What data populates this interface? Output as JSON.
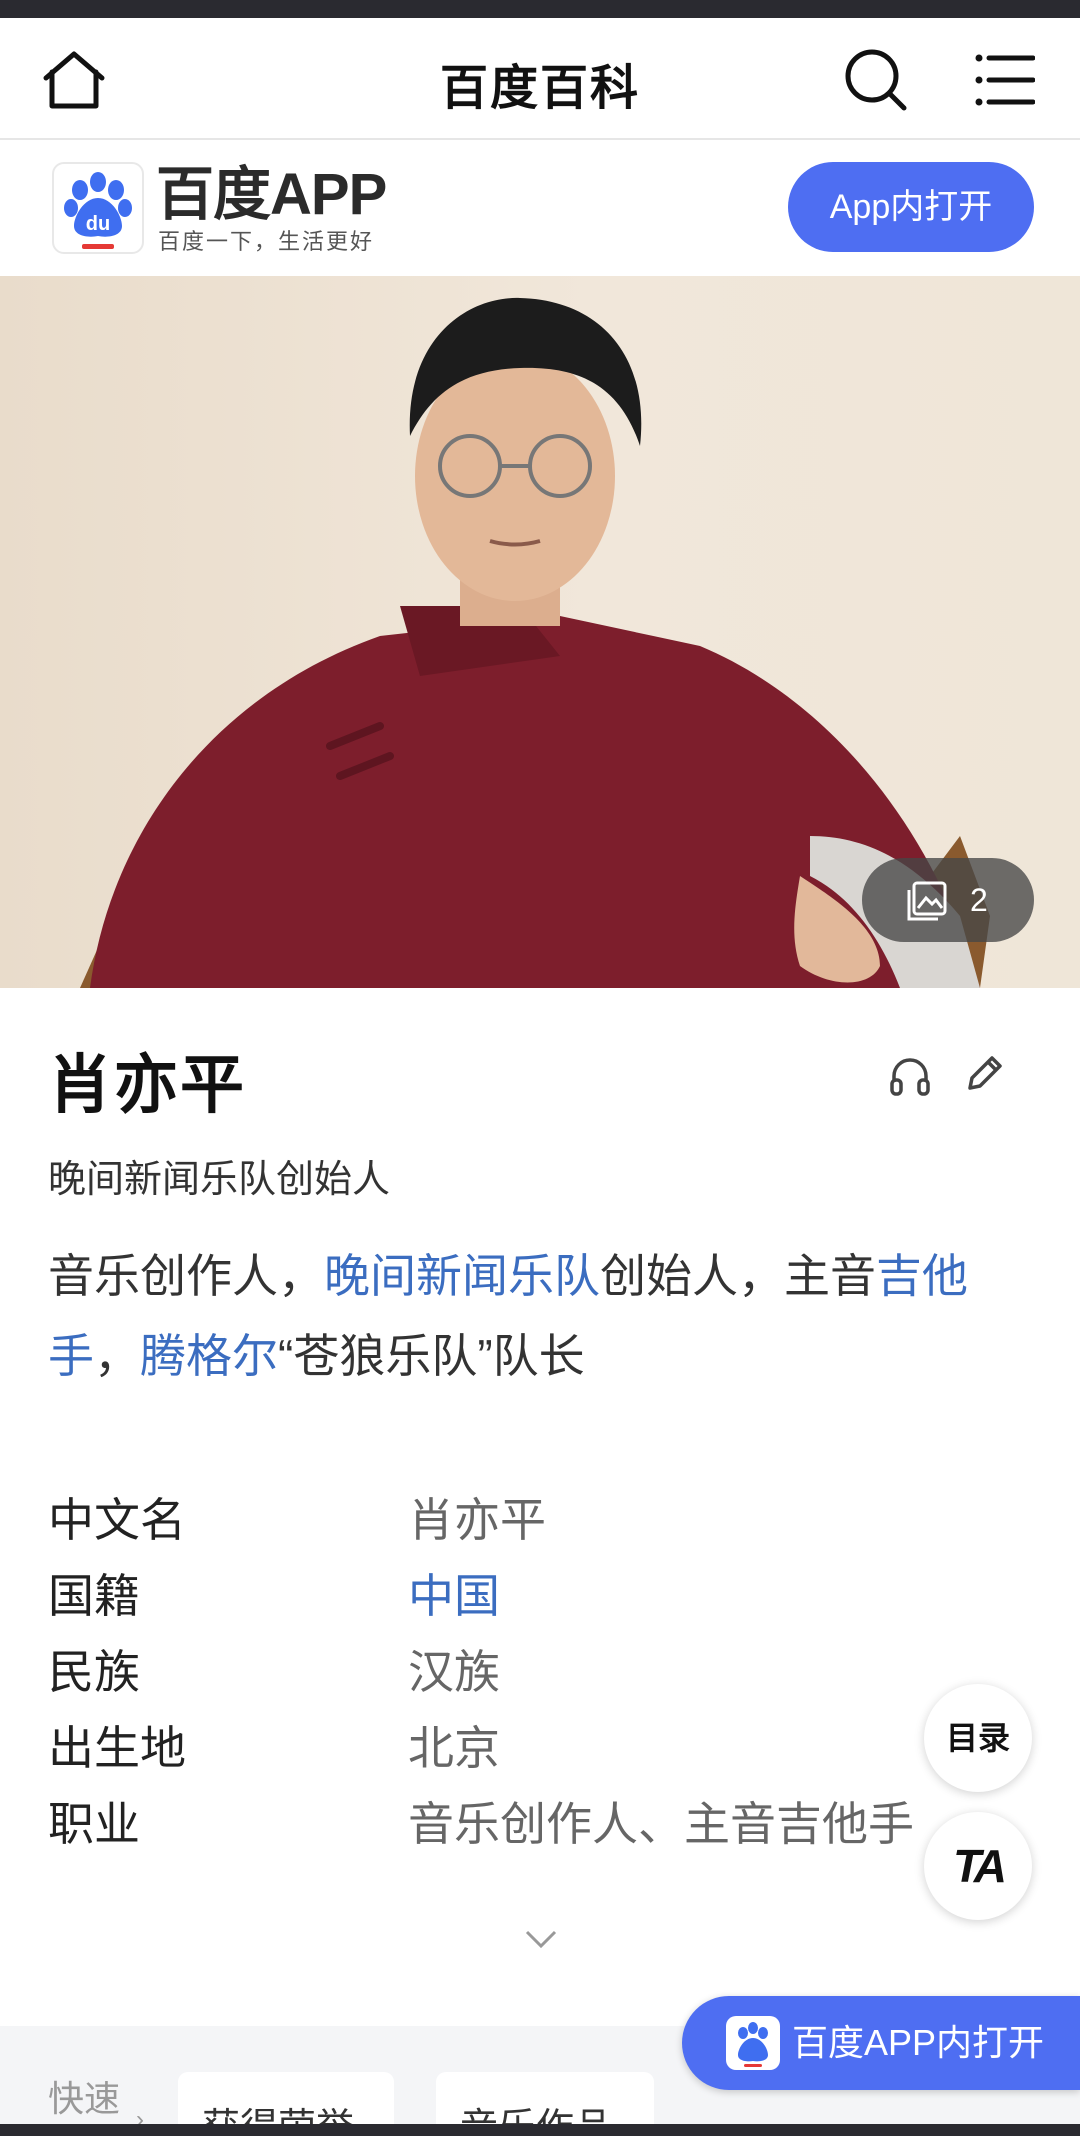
{
  "nav": {
    "title": "百度百科",
    "icons": [
      "home-icon",
      "search-icon",
      "menu-icon"
    ]
  },
  "app_banner": {
    "name": "百度APP",
    "slogan": "百度一下，生活更好",
    "open_button": "App内打开",
    "logo_text": "du",
    "brand_color": "#4e6ef2"
  },
  "hero": {
    "gallery_count": "2"
  },
  "entry": {
    "title": "肖亦平",
    "subtitle": "晚间新闻乐队创始人",
    "summary": {
      "p1": "音乐创作人，",
      "link1": "晚间新闻乐队",
      "p2": "创始人，主音",
      "link2": "吉他手",
      "p3": "，",
      "link3": "腾格尔",
      "p4": "“苍狼乐队”队长"
    }
  },
  "info": [
    {
      "key": "中文名",
      "value": "肖亦平",
      "link": false
    },
    {
      "key": "国籍",
      "value": "中国",
      "link": true
    },
    {
      "key": "民族",
      "value": "汉族",
      "link": false
    },
    {
      "key": "出生地",
      "value": "北京",
      "link": false
    },
    {
      "key": "职业",
      "value": "音乐创作人、主音吉他手",
      "link": false
    }
  ],
  "floating": {
    "toc": "目录",
    "ta": "TA"
  },
  "quickbar": {
    "label": "快速",
    "arrow": "›",
    "chips": [
      "获得荣誉",
      "音乐作品"
    ]
  },
  "open_app_float": {
    "label": "百度APP内打开"
  },
  "colors": {
    "link": "#3b6dc0",
    "accent": "#4e6ef2"
  }
}
